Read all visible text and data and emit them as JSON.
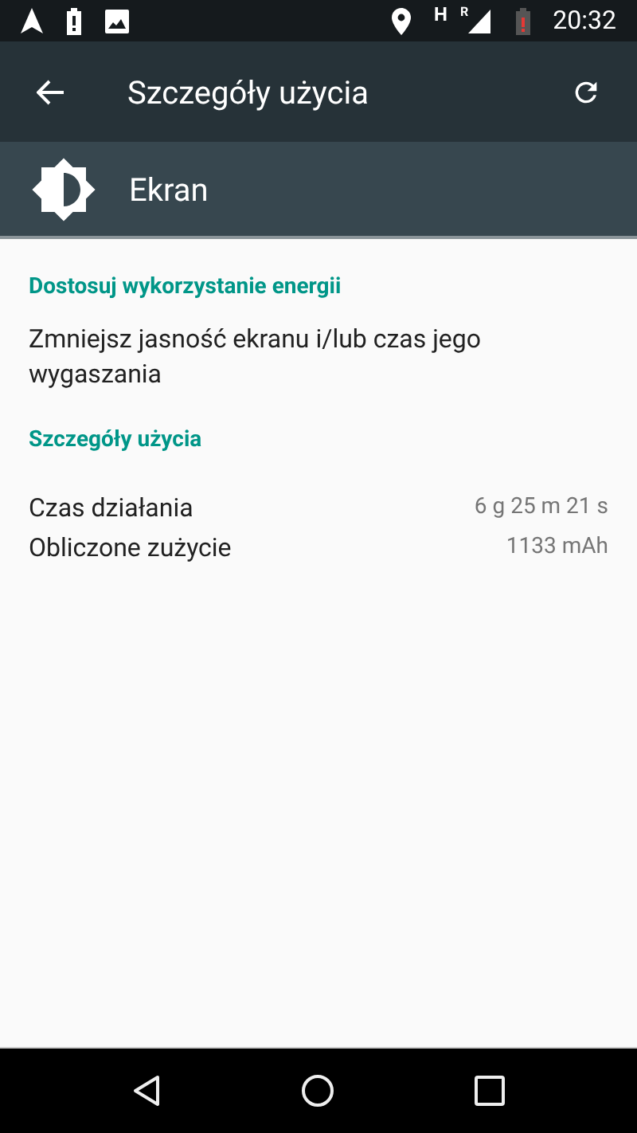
{
  "status_bar": {
    "network_type": "H",
    "roaming": "R",
    "time": "20:32"
  },
  "toolbar": {
    "title": "Szczegóły użycia"
  },
  "header": {
    "title": "Ekran"
  },
  "sections": [
    {
      "heading": "Dostosuj wykorzystanie energii",
      "items": [
        {
          "kind": "action",
          "label": "Zmniejsz jasność ekranu i/lub czas jego wygaszania"
        }
      ]
    },
    {
      "heading": "Szczegóły użycia",
      "items": [
        {
          "kind": "stat",
          "label": "Czas działania",
          "value": "6 g 25 m 21 s"
        },
        {
          "kind": "stat",
          "label": "Obliczone zużycie",
          "value": "1133 mAh"
        }
      ]
    }
  ]
}
